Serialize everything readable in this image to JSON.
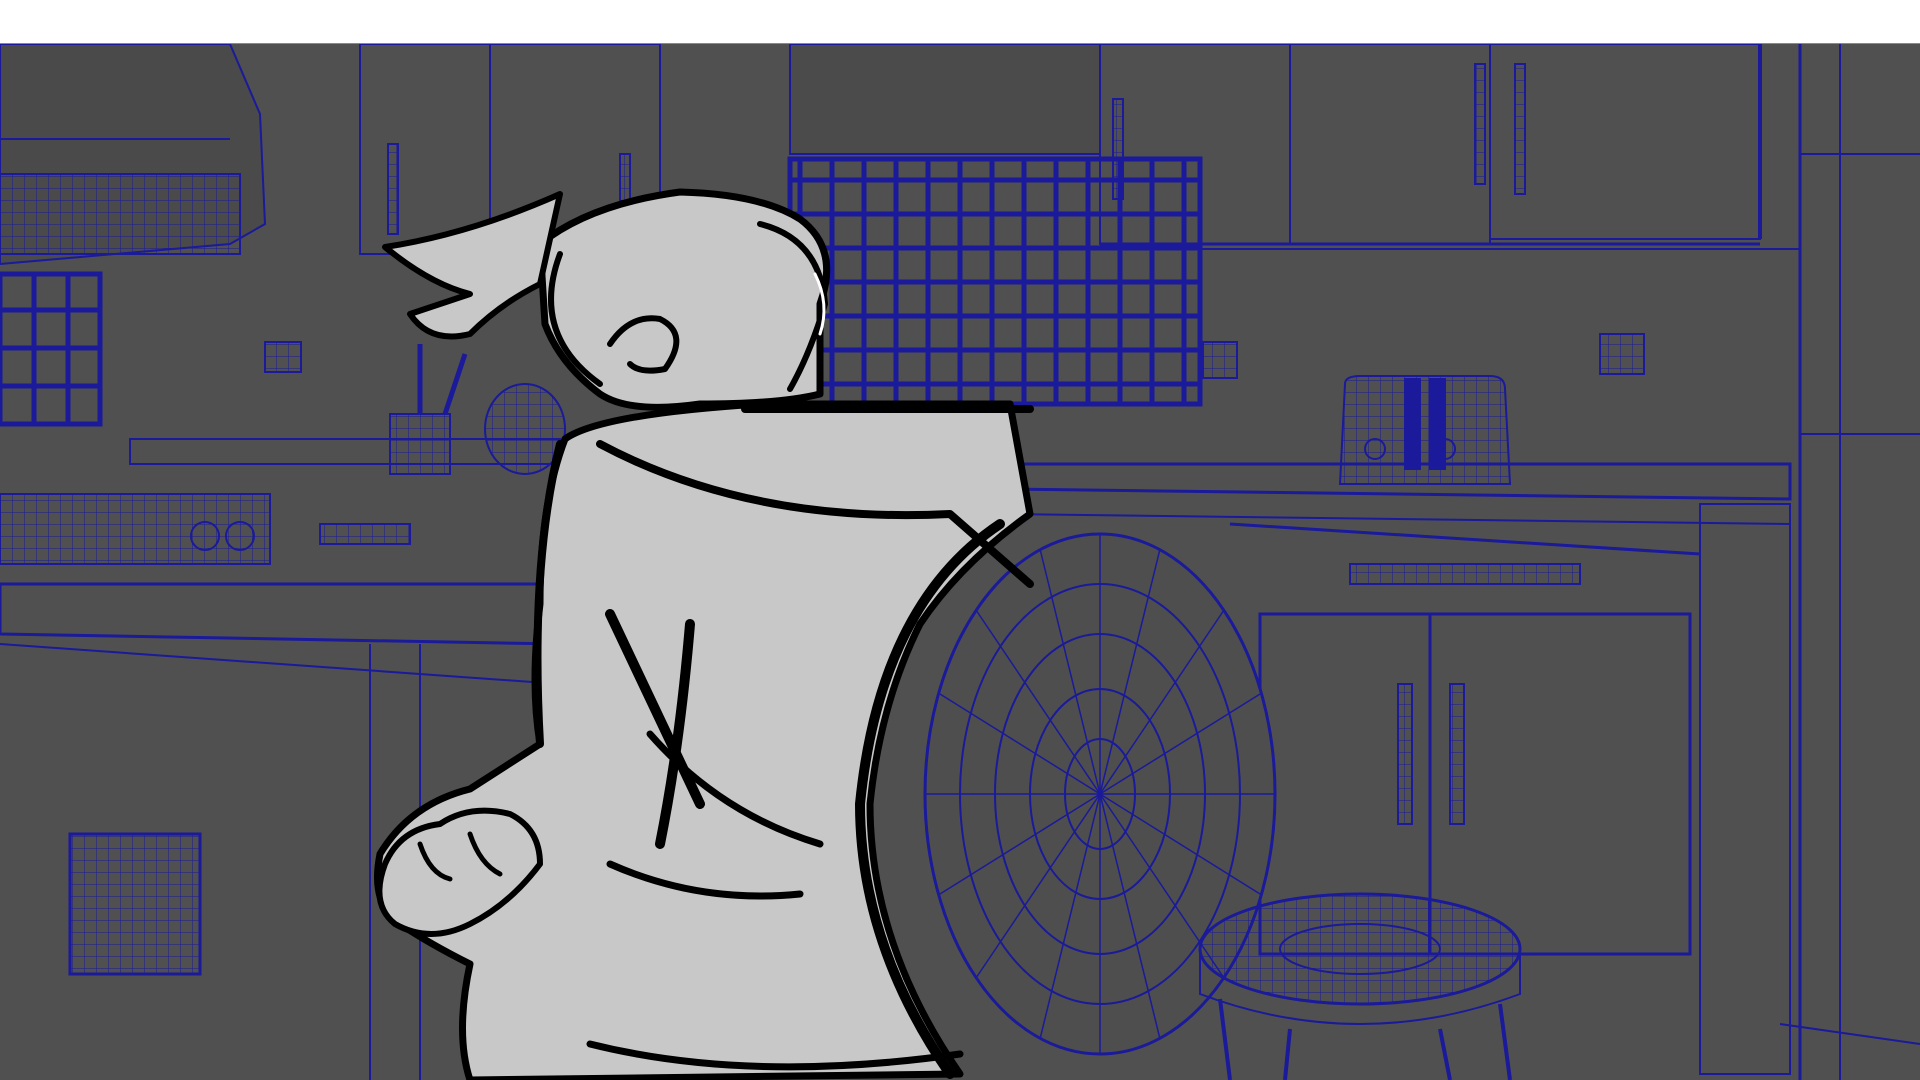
{
  "scene": {
    "description_visible_text": "",
    "colors": {
      "background": "#505050",
      "wireframe": "#1a1a9a",
      "sketch_fill": "#c8c8c8",
      "sketch_stroke": "#000000",
      "top_strip": "#ffffff"
    },
    "layers": [
      "wireframe-kitchen",
      "storyboard-sketch"
    ]
  }
}
